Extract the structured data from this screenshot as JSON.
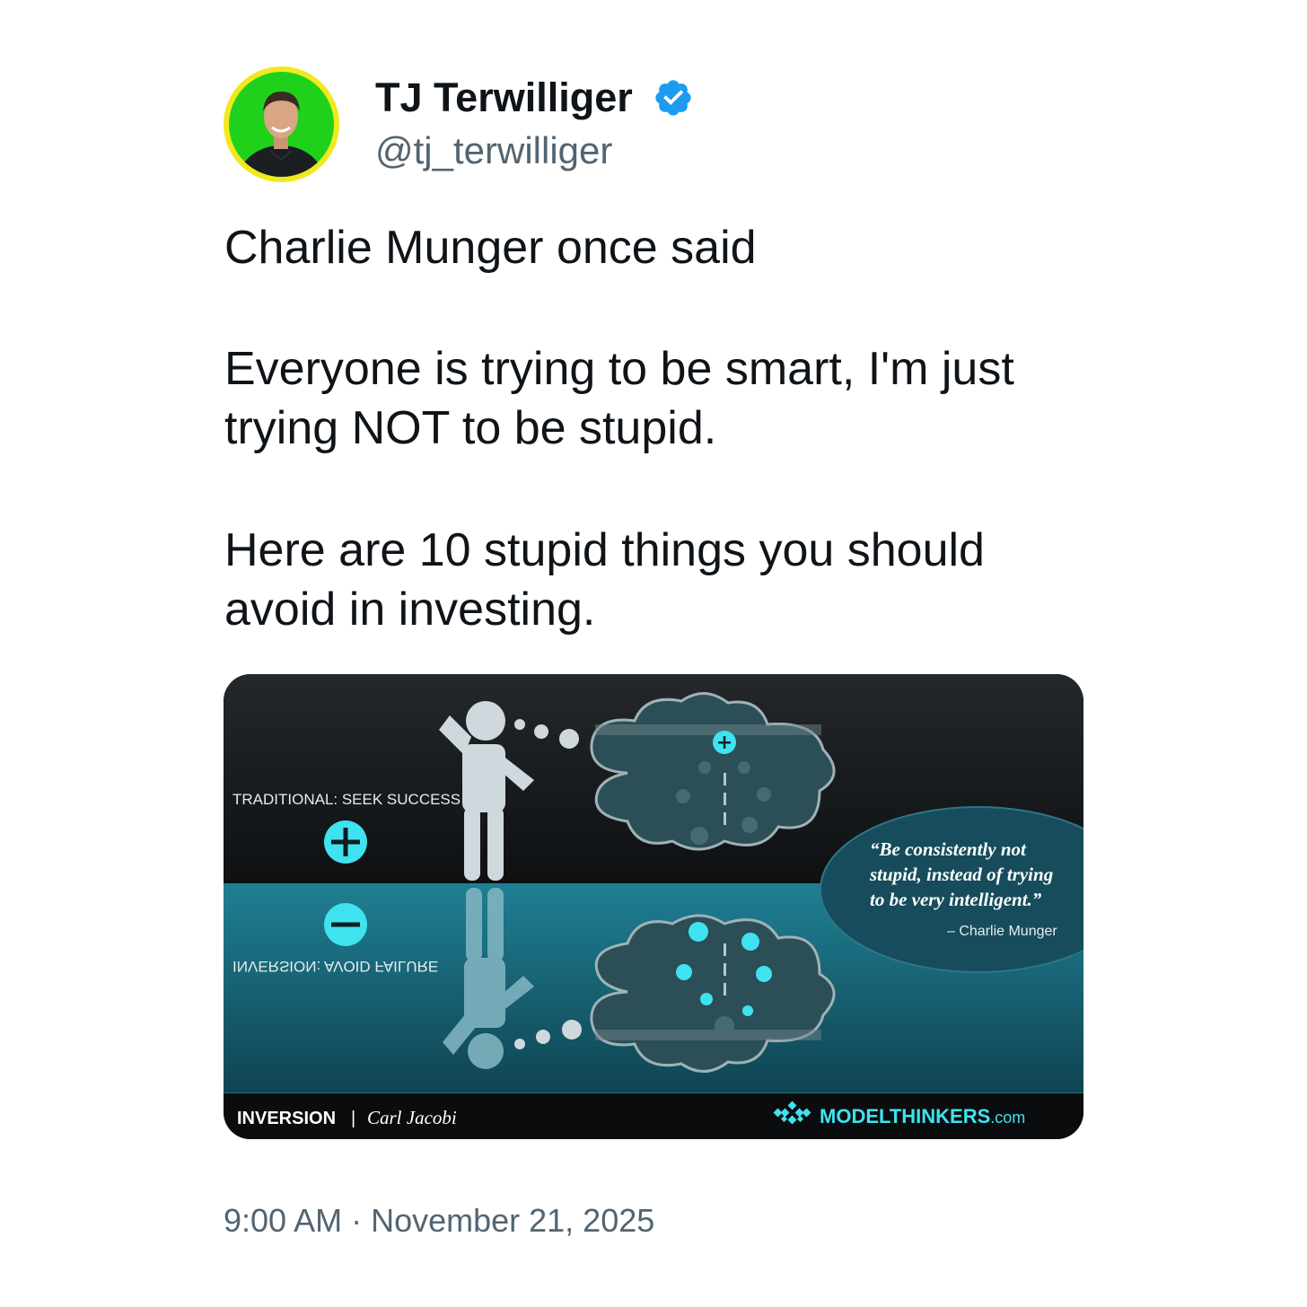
{
  "author": {
    "display_name": "TJ Terwilliger",
    "handle": "@tj_terwilliger",
    "verified": true,
    "avatar_ring_color": "#f2e81f",
    "avatar_bg_color": "#1fd11b"
  },
  "tweet": {
    "paragraphs": [
      "Charlie Munger once said",
      "Everyone is trying to be smart, I'm just trying NOT to be stupid.",
      "Here are 10 stupid things you should avoid in investing."
    ],
    "timestamp": "9:00 AM · November 21, 2025"
  },
  "media": {
    "top_label": "TRADITIONAL: SEEK SUCCESS",
    "bottom_label": "INVERSION: AVOID FAILURE",
    "quote_line1": "“Be consistently not",
    "quote_line2": "stupid, instead of trying",
    "quote_line3": "to be very intelligent.”",
    "quote_author": "– Charlie Munger",
    "footer_title": "INVERSION",
    "footer_separator": "|",
    "footer_subtitle": "Carl Jacobi",
    "brand_model": "MODEL",
    "brand_thinkers": "THINKERS",
    "brand_com": ".com",
    "accent_color": "#3fe3f0",
    "teal_color": "#1b6f82"
  }
}
